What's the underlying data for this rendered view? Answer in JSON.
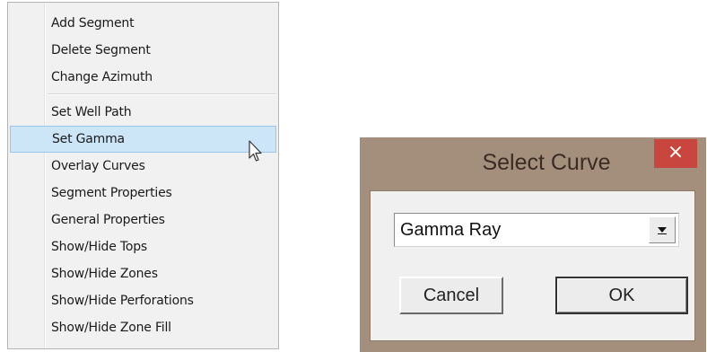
{
  "context_menu": {
    "groups": [
      [
        "Add Segment",
        "Delete Segment",
        "Change Azimuth"
      ],
      [
        "Set Well Path",
        "Set Gamma",
        "Overlay Curves",
        "Segment Properties",
        "General Properties",
        "Show/Hide Tops",
        "Show/Hide Zones",
        "Show/Hide Perforations",
        "Show/Hide Zone Fill"
      ]
    ],
    "highlighted_item": "Set Gamma"
  },
  "dialog": {
    "title": "Select Curve",
    "close_glyph": "×",
    "curve_select": {
      "value": "Gamma Ray"
    },
    "cancel_label": "Cancel",
    "ok_label": "OK"
  },
  "colors": {
    "menu_highlight": "#cde6f7",
    "dialog_frame": "#a48f7d",
    "close_button": "#c9463e"
  },
  "icons": {
    "cursor": "mouse-pointer-icon",
    "dropdown": "chevron-down-icon"
  }
}
